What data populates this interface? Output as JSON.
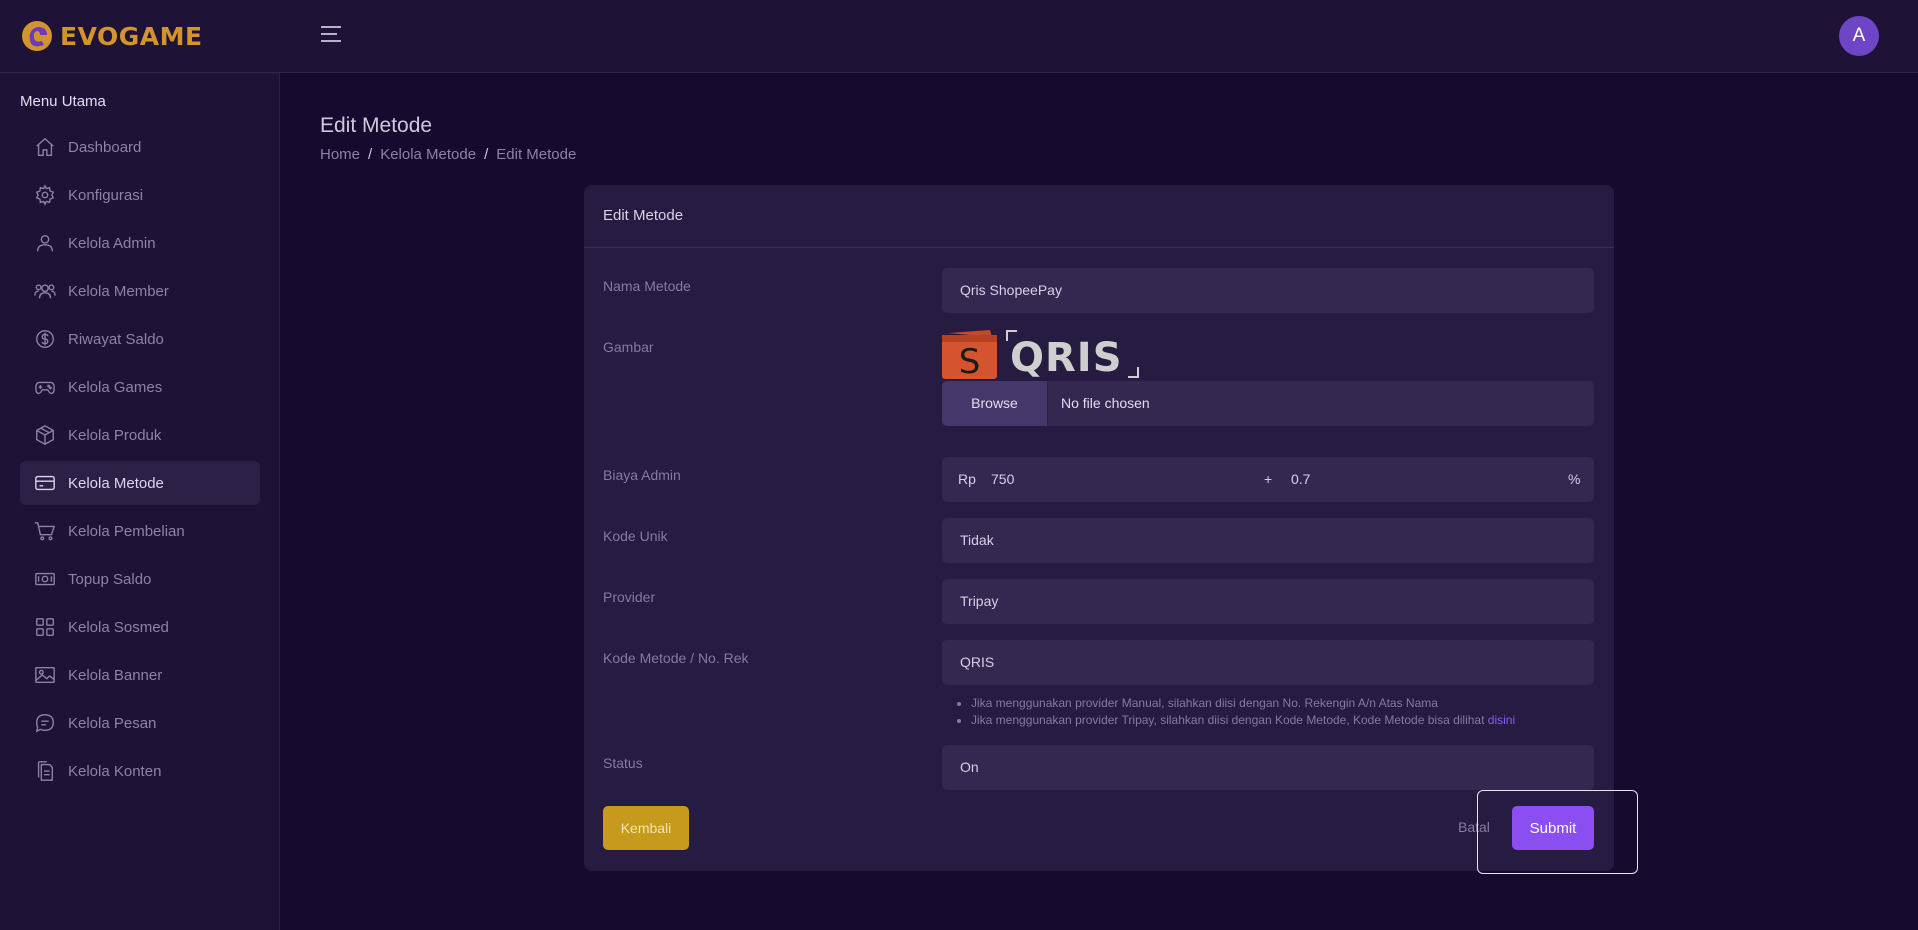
{
  "brand": {
    "name": "EVOGAME",
    "logo_icon": "evogame-logo-icon",
    "brand_color": "#d4942d"
  },
  "header": {
    "menu_icon": "hamburger-icon",
    "avatar_initial": "A"
  },
  "sidebar": {
    "section_title": "Menu Utama",
    "items": [
      {
        "label": "Dashboard",
        "icon": "home-icon"
      },
      {
        "label": "Konfigurasi",
        "icon": "gear-icon"
      },
      {
        "label": "Kelola Admin",
        "icon": "user-icon"
      },
      {
        "label": "Kelola Member",
        "icon": "users-icon"
      },
      {
        "label": "Riwayat Saldo",
        "icon": "dollar-circle-icon"
      },
      {
        "label": "Kelola Games",
        "icon": "gamepad-icon"
      },
      {
        "label": "Kelola Produk",
        "icon": "box-icon"
      },
      {
        "label": "Kelola Metode",
        "icon": "credit-card-icon",
        "active": true
      },
      {
        "label": "Kelola Pembelian",
        "icon": "cart-icon"
      },
      {
        "label": "Topup Saldo",
        "icon": "cash-icon"
      },
      {
        "label": "Kelola Sosmed",
        "icon": "grid-icon"
      },
      {
        "label": "Kelola Banner",
        "icon": "image-icon"
      },
      {
        "label": "Kelola Pesan",
        "icon": "chat-icon"
      },
      {
        "label": "Kelola Konten",
        "icon": "document-icon"
      }
    ]
  },
  "page": {
    "title": "Edit Metode",
    "breadcrumb": [
      "Home",
      "Kelola Metode",
      "Edit Metode"
    ],
    "breadcrumb_sep": "/"
  },
  "form": {
    "card_title": "Edit Metode",
    "nama_metode": {
      "label": "Nama Metode",
      "value": "Qris ShopeePay"
    },
    "gambar": {
      "label": "Gambar",
      "browse_label": "Browse",
      "file_status": "No file chosen",
      "preview_text": "QRIS",
      "wallet_letter": "S"
    },
    "biaya_admin": {
      "label": "Biaya Admin",
      "prefix": "Rp",
      "fixed_value": "750",
      "plus": "+",
      "percent_value": "0.7",
      "suffix": "%"
    },
    "kode_unik": {
      "label": "Kode Unik",
      "value": "Tidak"
    },
    "provider": {
      "label": "Provider",
      "value": "Tripay"
    },
    "kode_metode": {
      "label": "Kode Metode / No. Rek",
      "value": "QRIS",
      "hint_1": "Jika menggunakan provider Manual, silahkan diisi dengan No. Rekengin A/n Atas Nama",
      "hint_2": "Jika menggunakan provider Tripay, silahkan diisi dengan Kode Metode, Kode Metode bisa dilihat",
      "hint_link": "disini"
    },
    "status": {
      "label": "Status",
      "value": "On"
    },
    "buttons": {
      "back": "Kembali",
      "cancel": "Batal",
      "submit": "Submit"
    }
  },
  "colors": {
    "accent": "#8b4ef0",
    "warning": "#c69a1c",
    "bg": "#160a2e",
    "panel": "#1e1337"
  }
}
